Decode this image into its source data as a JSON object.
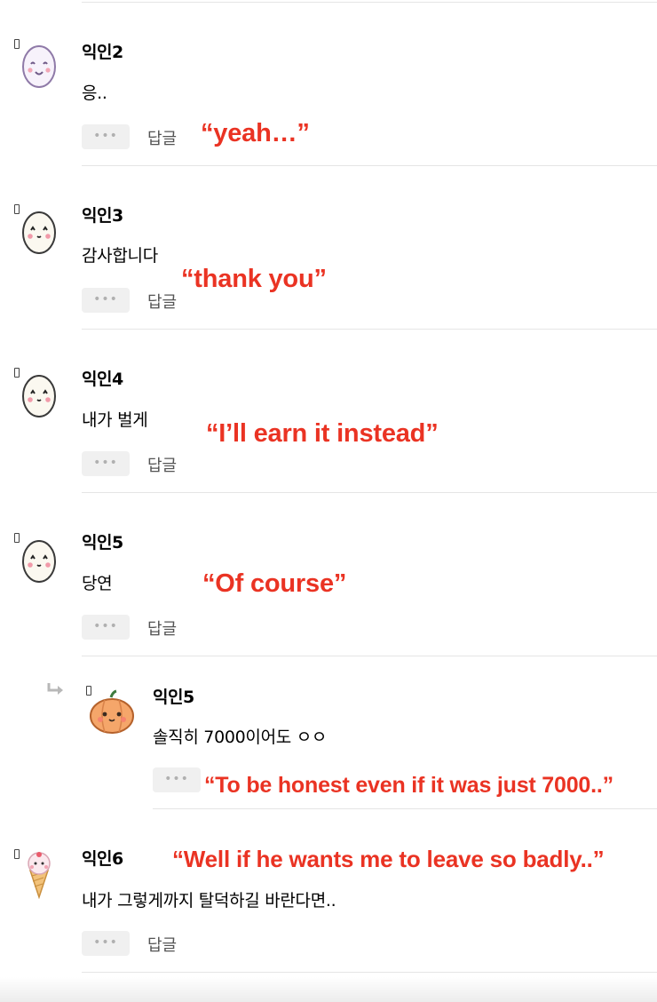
{
  "reply_label": "답글",
  "more_label": "•••",
  "annotation_color": "#ea3323",
  "comments": [
    {
      "user": "익인2",
      "text": "응..",
      "avatar": "egg-smile-icon",
      "annotation": "“yeah…”"
    },
    {
      "user": "익인3",
      "text": "감사합니다",
      "avatar": "egg-face-icon",
      "annotation": "“thank you”"
    },
    {
      "user": "익인4",
      "text": "내가 벌게",
      "avatar": "egg-face-icon",
      "annotation": "“I’ll earn it instead”"
    },
    {
      "user": "익인5",
      "text": "당연",
      "avatar": "egg-face-icon",
      "annotation": "“Of course”"
    },
    {
      "user": "익인5",
      "text": "솔직히 7000이어도 ㅇㅇ",
      "avatar": "pumpkin-icon",
      "annotation": "“To be honest even if it was just 7000..”",
      "is_reply": true
    },
    {
      "user": "익인6",
      "text": "내가 그렇게까지 탈덕하길 바란다면..",
      "avatar": "ice-cream-icon",
      "annotation": "“Well if he wants me to leave so badly..”"
    }
  ]
}
